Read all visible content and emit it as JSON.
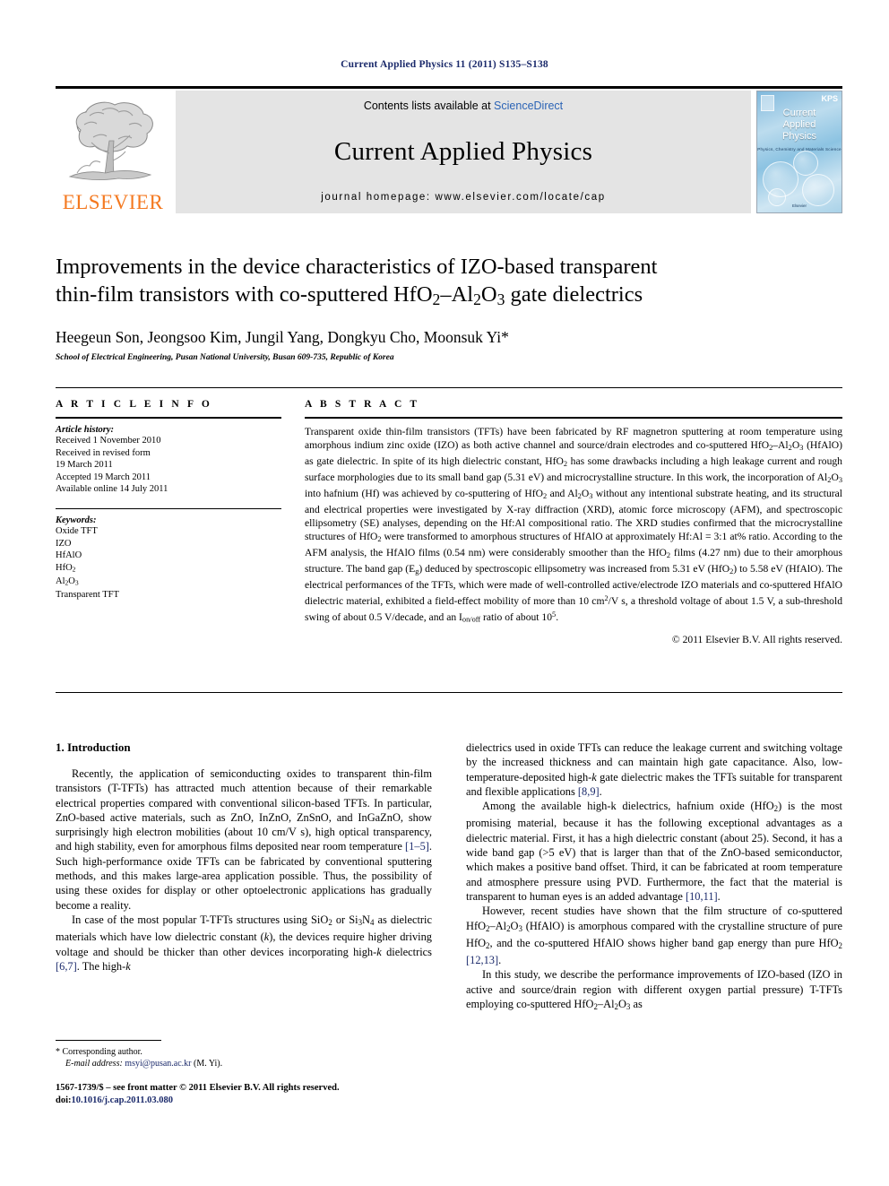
{
  "running_head": "Current Applied Physics 11 (2011) S135–S138",
  "masthead": {
    "publisher_name": "ELSEVIER",
    "publisher_logo_icon": "elsevier-tree-icon",
    "contents_prefix": "Contents lists available at",
    "sciencedirect_link": "ScienceDirect",
    "journal_name": "Current Applied Physics",
    "homepage_label": "journal homepage: www.elsevier.com/locate/cap",
    "cover": {
      "title_line1": "Current",
      "title_line2": "Applied",
      "title_line3": "Physics",
      "subtitle": "Physics, Chemistry and Materials Science",
      "society_mark": "KPS",
      "footer_mark": "Elsevier"
    }
  },
  "article": {
    "title_line1": "Improvements in the device characteristics of IZO-based transparent",
    "title_line2_pre": "thin-film transistors with co-sputtered HfO",
    "title_sub1": "2",
    "title_dash": "–Al",
    "title_sub2": "2",
    "title_mid": "O",
    "title_sub3": "3",
    "title_line2_post": " gate dielectrics",
    "authors": "Heegeun Son, Jeongsoo Kim, Jungil Yang, Dongkyu Cho, Moonsuk Yi*",
    "affiliation": "School of Electrical Engineering, Pusan National University, Busan 609-735, Republic of Korea"
  },
  "article_info": {
    "heading": "A R T I C L E   I N F O",
    "history_label": "Article history:",
    "history_lines": [
      "Received 1 November 2010",
      "Received in revised form",
      "19 March 2011",
      "Accepted 19 March 2011",
      "Available online 14 July 2011"
    ],
    "keywords_label": "Keywords:",
    "keywords": [
      "Oxide TFT",
      "IZO",
      "HfAlO",
      "HfO2",
      "Al2O3",
      "Transparent TFT"
    ]
  },
  "abstract": {
    "heading": "A B S T R A C T",
    "text": "Transparent oxide thin-film transistors (TFTs) have been fabricated by RF magnetron sputtering at room temperature using amorphous indium zinc oxide (IZO) as both active channel and source/drain electrodes and co-sputtered HfO2–Al2O3 (HfAlO) as gate dielectric. In spite of its high dielectric constant, HfO2 has some drawbacks including a high leakage current and rough surface morphologies due to its small band gap (5.31 eV) and microcrystalline structure. In this work, the incorporation of Al2O3 into hafnium (Hf) was achieved by co-sputtering of HfO2 and Al2O3 without any intentional substrate heating, and its structural and electrical properties were investigated by X-ray diffraction (XRD), atomic force microscopy (AFM), and spectroscopic ellipsometry (SE) analyses, depending on the Hf:Al compositional ratio. The XRD studies confirmed that the microcrystalline structures of HfO2 were transformed to amorphous structures of HfAlO at approximately Hf:Al = 3:1 at% ratio. According to the AFM analysis, the HfAlO films (0.54 nm) were considerably smoother than the HfO2 films (4.27 nm) due to their amorphous structure. The band gap (Eg) deduced by spectroscopic ellipsometry was increased from 5.31 eV (HfO2) to 5.58 eV (HfAlO). The electrical performances of the TFTs, which were made of well-controlled active/electrode IZO materials and co-sputtered HfAlO dielectric material, exhibited a field-effect mobility of more than 10 cm2/V s, a threshold voltage of about 1.5 V, a sub-threshold swing of about 0.5 V/decade, and an Ion/Ioff ratio of about 105.",
    "copyright": "© 2011 Elsevier B.V. All rights reserved."
  },
  "introduction": {
    "heading": "1.  Introduction",
    "left_paragraphs": [
      "Recently, the application of semiconducting oxides to transparent thin-film transistors (T-TFTs) has attracted much attention because of their remarkable electrical properties compared with conventional silicon-based TFTs. In particular, ZnO-based active materials, such as ZnO, InZnO, ZnSnO, and InGaZnO, show surprisingly high electron mobilities (about 10 cm/V s), high optical transparency, and high stability, even for amorphous films deposited near room temperature [1–5]. Such high-performance oxide TFTs can be fabricated by conventional sputtering methods, and this makes large-area application possible. Thus, the possibility of using these oxides for display or other optoelectronic applications has gradually become a reality.",
      "In case of the most popular T-TFTs structures using SiO2 or Si3N4 as dielectric materials which have low dielectric constant (k), the devices require higher driving voltage and should be thicker than other devices incorporating high-k dielectrics [6,7]. The high-k"
    ],
    "right_paragraphs": [
      "dielectrics used in oxide TFTs can reduce the leakage current and switching voltage by the increased thickness and can maintain high gate capacitance. Also, low-temperature-deposited high-k gate dielectric makes the TFTs suitable for transparent and flexible applications [8,9].",
      "Among the available high-k dielectrics, hafnium oxide (HfO2) is the most promising material, because it has the following exceptional advantages as a dielectric material. First, it has a high dielectric constant (about 25). Second, it has a wide band gap (>5 eV) that is larger than that of the ZnO-based semiconductor, which makes a positive band offset. Third, it can be fabricated at room temperature and atmosphere pressure using PVD. Furthermore, the fact that the material is transparent to human eyes is an added advantage [10,11].",
      "However, recent studies have shown that the film structure of co-sputtered HfO2–Al2O3 (HfAlO) is amorphous compared with the crystalline structure of pure HfO2, and the co-sputtered HfAlO shows higher band gap energy than pure HfO2 [12,13].",
      "In this study, we describe the performance improvements of IZO-based (IZO in active and source/drain region with different oxygen partial pressure) T-TFTs employing co-sputtered HfO2–Al2O3 as"
    ]
  },
  "footnote": {
    "corresponding_marker": "*",
    "corresponding_label": "Corresponding author.",
    "email_label": "E-mail address:",
    "email": "msyi@pusan.ac.kr",
    "email_suffix": "(M. Yi)."
  },
  "footer": {
    "front_matter": "1567-1739/$ – see front matter © 2011 Elsevier B.V. All rights reserved.",
    "doi_label": "doi:",
    "doi": "10.1016/j.cap.2011.03.080"
  },
  "colors": {
    "link_blue": "#1b2a6b",
    "sciencedirect_blue": "#2b63b5",
    "elsevier_orange": "#F47920",
    "band_gray": "#e4e4e4"
  }
}
